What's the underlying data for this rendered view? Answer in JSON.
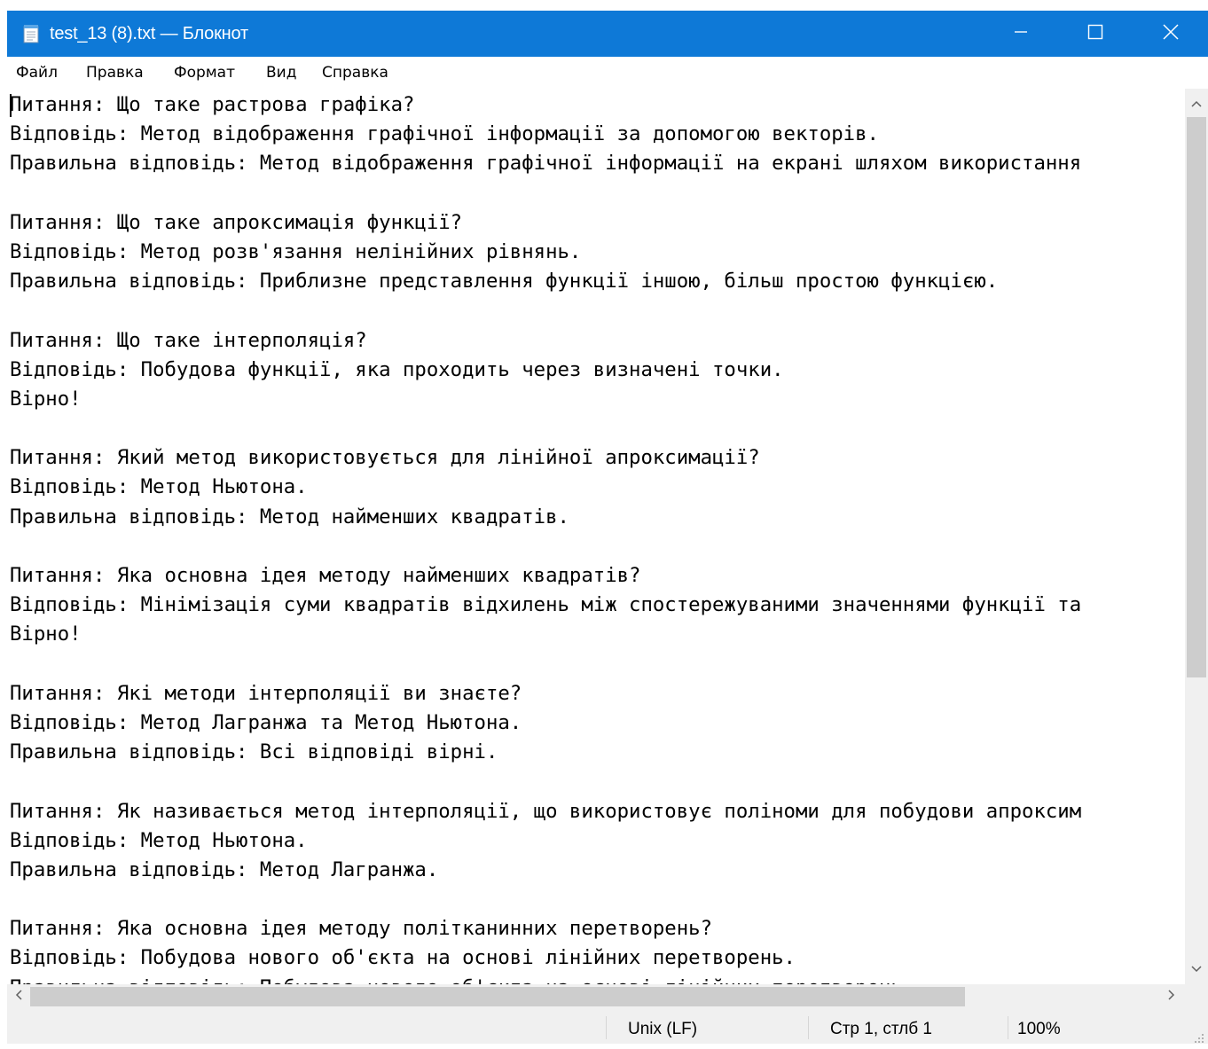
{
  "window": {
    "title": "test_13 (8).txt — Блокнот",
    "titlebar_color": "#0e79d7"
  },
  "icons": {
    "app": "notepad-icon",
    "minimize": "minimize-icon",
    "maximize": "maximize-icon",
    "close": "close-icon"
  },
  "menu": {
    "file": "Файл",
    "edit": "Правка",
    "format": "Формат",
    "view": "Вид",
    "help": "Справка"
  },
  "editor": {
    "lines": [
      "Питання: Що таке растрова графіка?",
      "Відповідь: Метод відображення графічної інформації за допомогою векторів.",
      "Правильна відповідь: Метод відображення графічної інформації на екрані шляхом використання",
      "",
      "Питання: Що таке апроксимація функції?",
      "Відповідь: Метод розв'язання нелінійних рівнянь.",
      "Правильна відповідь: Приблизне представлення функції іншою, більш простою функцією.",
      "",
      "Питання: Що таке інтерполяція?",
      "Відповідь: Побудова функції, яка проходить через визначені точки.",
      "Вірно!",
      "",
      "Питання: Який метод використовується для лінійної апроксимації?",
      "Відповідь: Метод Ньютона.",
      "Правильна відповідь: Метод найменших квадратів.",
      "",
      "Питання: Яка основна ідея методу найменших квадратів?",
      "Відповідь: Мінімізація суми квадратів відхилень між спостережуваними значеннями функції та",
      "Вірно!",
      "",
      "Питання: Які методи інтерполяції ви знаєте?",
      "Відповідь: Метод Лагранжа та Метод Ньютона.",
      "Правильна відповідь: Всі відповіді вірні.",
      "",
      "Питання: Як називається метод інтерполяції, що використовує поліноми для побудови апроксим",
      "Відповідь: Метод Ньютона.",
      "Правильна відповідь: Метод Лагранжа.",
      "",
      "Питання: Яка основна ідея методу політканинних перетворень?",
      "Відповідь: Побудова нового об'єкта на основі лінійних перетворень.",
      "Правильна відповідь: Побудова нового об'єкта на основі лінійних перетворень."
    ]
  },
  "statusbar": {
    "line_ending": "Unix (LF)",
    "position": "Стр 1, стлб 1",
    "zoom": "100%"
  }
}
